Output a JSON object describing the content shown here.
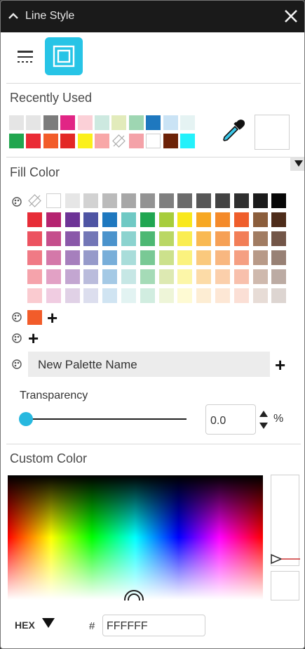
{
  "window": {
    "title": "Line Style"
  },
  "tabs": [
    {
      "icon": "line-style-icon",
      "selected": false
    },
    {
      "icon": "fill-style-icon",
      "selected": true
    }
  ],
  "recently_used": {
    "label": "Recently Used",
    "rows": [
      [
        "#e5e5e5",
        "#e5e5e5",
        "#7c7c7c",
        "#e12585",
        "#fbd0d7",
        "#cde9e0",
        "#e2ebbb",
        "#9ed6b2",
        "#1e78bf",
        "#cae3f5",
        "#e5f3f3"
      ],
      [
        "#21a64f",
        "#ea2b35",
        "#f25c2a",
        "#e32826",
        "#fbf01b",
        "#f8a7a7",
        "none",
        "#f4a2a8",
        "#ffffff",
        "#6d2207",
        "#24f1fb"
      ]
    ]
  },
  "fill_color": {
    "label": "Fill Color",
    "top_row": [
      "none",
      "#ffffff",
      "#e6e6e6",
      "#d2d2d2",
      "#bbbbbb",
      "#a7a7a7",
      "#939393",
      "#7f7f7f",
      "#6b6b6b",
      "#575757",
      "#434343",
      "#2f2f2f",
      "#1b1b1b",
      "#070707"
    ],
    "grid": [
      [
        "#e72c37",
        "#b52370",
        "#6d3396",
        "#4e54a3",
        "#1e78bf",
        "#6fc9c4",
        "#20a651",
        "#a7cd3c",
        "#f9e81d",
        "#f7a823",
        "#f48a2a",
        "#ef5e2b",
        "#8b5e3c",
        "#4e2c1a"
      ],
      [
        "#ec5260",
        "#c54e8c",
        "#8a58a9",
        "#7276b6",
        "#4b93cc",
        "#8cd3cf",
        "#4db873",
        "#bad765",
        "#faed51",
        "#f9b952",
        "#f6a055",
        "#f27e57",
        "#a17c62",
        "#735648"
      ],
      [
        "#f07a85",
        "#d478a9",
        "#a67fbd",
        "#969aca",
        "#78aed9",
        "#a9ddda",
        "#79c995",
        "#cce18c",
        "#fbf27e",
        "#fac97d",
        "#f8b780",
        "#f59f82",
        "#b89a88",
        "#988175"
      ],
      [
        "#f5a3ab",
        "#e2a1c5",
        "#c3a6d1",
        "#babcdc",
        "#a4c9e5",
        "#c6e7e5",
        "#a5dbb7",
        "#dde9b2",
        "#fcf6a8",
        "#fcdba7",
        "#fbcfab",
        "#f8c0ac",
        "#cfb9ad",
        "#bcaba3"
      ],
      [
        "#facbd0",
        "#f0cce1",
        "#e0d1e6",
        "#dcdeee",
        "#d0e4f2",
        "#e2f3f2",
        "#d1ede0",
        "#eef5d8",
        "#fefad3",
        "#fdedd3",
        "#fde7d5",
        "#fbdfd5",
        "#e7dcd6",
        "#ddd5d1"
      ]
    ]
  },
  "custom_palettes": [
    {
      "swatches": [
        "#f25c2a"
      ]
    },
    {
      "swatches": []
    }
  ],
  "new_palette": {
    "name": "New Palette Name"
  },
  "transparency": {
    "label": "Transparency",
    "value": "0.0",
    "unit": "%"
  },
  "custom_color": {
    "label": "Custom Color",
    "mode": "HEX",
    "hash": "#",
    "hex_value": "FFFFFF"
  }
}
